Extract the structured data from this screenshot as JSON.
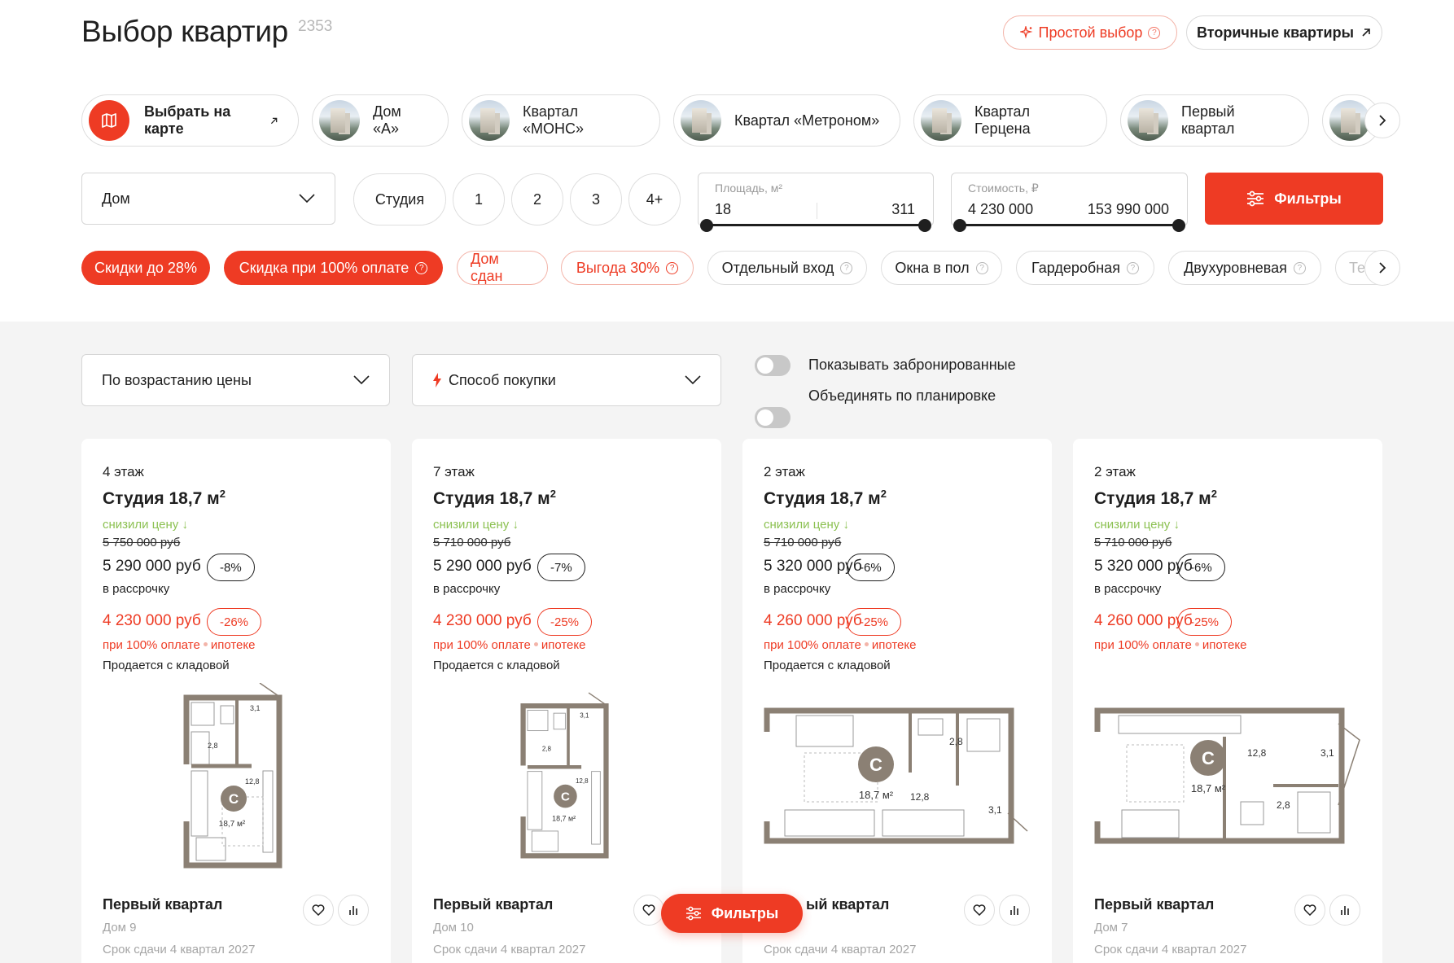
{
  "header": {
    "title": "Выбор квартир",
    "count": "2353",
    "simple_choice": "Простой выбор",
    "secondary": "Вторичные квартиры"
  },
  "projects": {
    "map": "Выбрать на карте",
    "items": [
      "Дом «А»",
      "Квартал «МОНС»",
      "Квартал «Метроном»",
      "Квартал Герцена",
      "Первый квартал"
    ]
  },
  "filters": {
    "house_select": "Дом",
    "rooms": [
      "Студия",
      "1",
      "2",
      "3",
      "4+"
    ],
    "area": {
      "label": "Площадь, м²",
      "min": "18",
      "max": "311"
    },
    "cost": {
      "label": "Стоимость, ₽",
      "min": "4 230 000",
      "max": "153 990 000"
    },
    "filters_button": "Фильтры"
  },
  "tags": {
    "discount28": "Скидки до 28%",
    "discount100": "Скидка при 100% оплате",
    "house_done": "Дом сдан",
    "benefit30": "Выгода 30%",
    "separate_entrance": "Отдельный вход",
    "floor_windows": "Окна в пол",
    "wardrobe": "Гардеробная",
    "two_level": "Двухуровневая",
    "more": "Те"
  },
  "list_controls": {
    "sort": "По возрастанию цены",
    "purchase": "Способ покупки",
    "show_booked": "Показывать забронированные",
    "group_by_layout": "Объединять по планировке"
  },
  "cards": [
    {
      "floor": "4 этаж",
      "type": "Студия 18,7 м",
      "reduced": "снизили цену",
      "old_price": "5 750 000 руб",
      "price": "5 290 000 руб",
      "discount": "-8%",
      "installment": "в рассрочку",
      "price2": "4 230 000 руб",
      "discount2": "-26%",
      "term_a": "при 100% оплате",
      "term_b": "ипотеке",
      "storage": "Продается с кладовой",
      "project": "Первый квартал",
      "house": "Дом 9",
      "deadline": "Срок сдачи 4 квартал 2027",
      "plan_area": "18,7 м²",
      "plan_rooms": [
        "3,1",
        "2,8",
        "12,8"
      ]
    },
    {
      "floor": "7 этаж",
      "type": "Студия 18,7 м",
      "reduced": "снизили цену",
      "old_price": "5 710 000 руб",
      "price": "5 290 000 руб",
      "discount": "-7%",
      "installment": "в рассрочку",
      "price2": "4 230 000 руб",
      "discount2": "-25%",
      "term_a": "при 100% оплате",
      "term_b": "ипотеке",
      "storage": "Продается с кладовой",
      "project": "Первый квартал",
      "house": "Дом 10",
      "deadline": "Срок сдачи 4 квартал 2027",
      "plan_area": "18,7 м²",
      "plan_rooms": [
        "3,1",
        "2,8",
        "12,8"
      ]
    },
    {
      "floor": "2 этаж",
      "type": "Студия 18,7 м",
      "reduced": "снизили цену",
      "old_price": "5 710 000 руб",
      "price": "5 320 000 руб",
      "discount": "-6%",
      "installment": "в рассрочку",
      "price2": "4 260 000 руб",
      "discount2": "-25%",
      "term_a": "при 100% оплате",
      "term_b": "ипотеке",
      "storage": "Продается с кладовой",
      "project": "ый квартал",
      "house": "",
      "deadline": "Срок сдачи 4 квартал 2027",
      "plan_area": "18,7 м²",
      "plan_rooms": [
        "2,8",
        "12,8",
        "3,1"
      ]
    },
    {
      "floor": "2 этаж",
      "type": "Студия 18,7 м",
      "reduced": "снизили цену",
      "old_price": "5 710 000 руб",
      "price": "5 320 000 руб",
      "discount": "-6%",
      "installment": "в рассрочку",
      "price2": "4 260 000 руб",
      "discount2": "-25%",
      "term_a": "при 100% оплате",
      "term_b": "ипотеке",
      "storage": "",
      "project": "Первый квартал",
      "house": "Дом 7",
      "deadline": "Срок сдачи 4 квартал 2027",
      "plan_area": "18,7 м²",
      "plan_rooms": [
        "12,8",
        "3,1",
        "2,8"
      ]
    }
  ],
  "float_filters": "Фильтры",
  "colors": {
    "accent": "#ee3b24",
    "green": "#8cc152",
    "gray_bg": "#f4f4f4"
  }
}
